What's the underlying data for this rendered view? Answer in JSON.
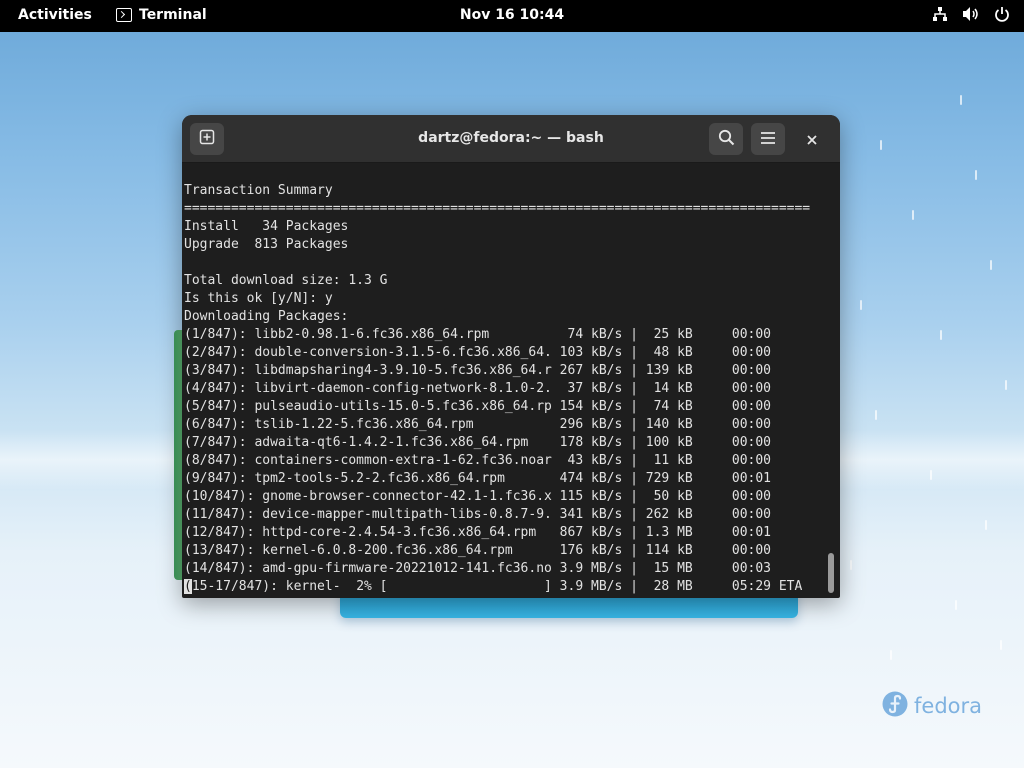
{
  "topbar": {
    "activities": "Activities",
    "app_name": "Terminal",
    "clock": "Nov 16  10:44"
  },
  "window": {
    "title": "dartz@fedora:~ — bash"
  },
  "terminal": {
    "lines": [
      "Transaction Summary",
      "================================================================================",
      "Install   34 Packages",
      "Upgrade  813 Packages",
      "",
      "Total download size: 1.3 G",
      "Is this ok [y/N]: y",
      "Downloading Packages:",
      "(1/847): libb2-0.98.1-6.fc36.x86_64.rpm          74 kB/s |  25 kB     00:00",
      "(2/847): double-conversion-3.1.5-6.fc36.x86_64. 103 kB/s |  48 kB     00:00",
      "(3/847): libdmapsharing4-3.9.10-5.fc36.x86_64.r 267 kB/s | 139 kB     00:00",
      "(4/847): libvirt-daemon-config-network-8.1.0-2.  37 kB/s |  14 kB     00:00",
      "(5/847): pulseaudio-utils-15.0-5.fc36.x86_64.rp 154 kB/s |  74 kB     00:00",
      "(6/847): tslib-1.22-5.fc36.x86_64.rpm           296 kB/s | 140 kB     00:00",
      "(7/847): adwaita-qt6-1.4.2-1.fc36.x86_64.rpm    178 kB/s | 100 kB     00:00",
      "(8/847): containers-common-extra-1-62.fc36.noar  43 kB/s |  11 kB     00:00",
      "(9/847): tpm2-tools-5.2-2.fc36.x86_64.rpm       474 kB/s | 729 kB     00:01",
      "(10/847): gnome-browser-connector-42.1-1.fc36.x 115 kB/s |  50 kB     00:00",
      "(11/847): device-mapper-multipath-libs-0.8.7-9. 341 kB/s | 262 kB     00:00",
      "(12/847): httpd-core-2.4.54-3.fc36.x86_64.rpm   867 kB/s | 1.3 MB     00:01",
      "(13/847): kernel-6.0.8-200.fc36.x86_64.rpm      176 kB/s | 114 kB     00:00",
      "(14/847): amd-gpu-firmware-20221012-141.fc36.no 3.9 MB/s |  15 MB     00:03"
    ],
    "progress_line_cursor_char": "(",
    "progress_line_rest": "15-17/847): kernel-  2% [                    ] 3.9 MB/s |  28 MB     05:29 ETA"
  },
  "icons": {
    "new_tab": "new-tab-icon",
    "search": "search-icon",
    "menu": "hamburger-menu-icon",
    "close": "close-icon",
    "network": "network-icon",
    "volume": "volume-icon",
    "power": "power-icon",
    "fedora": "fedora-logo-icon"
  },
  "branding": {
    "watermark": "fedora"
  },
  "colors": {
    "topbar": "#000000",
    "headerbar": "#303030",
    "terminal_bg": "#1e1e1e",
    "terminal_fg": "#e2e2e2"
  }
}
